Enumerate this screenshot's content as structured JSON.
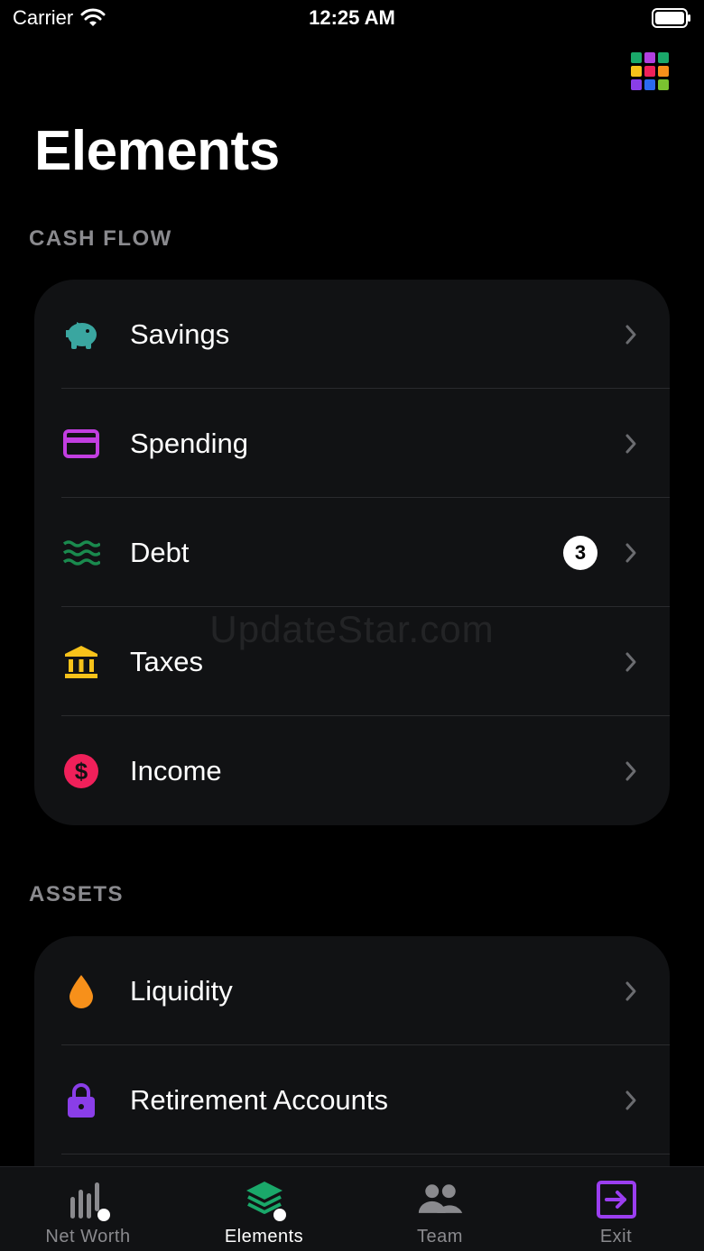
{
  "status_bar": {
    "carrier": "Carrier",
    "time": "12:25 AM"
  },
  "header": {
    "title": "Elements",
    "grid_icon": "apps-grid-icon"
  },
  "sections": {
    "cash_flow": {
      "title": "CASH FLOW",
      "items": [
        {
          "label": "Savings",
          "icon": "piggy-bank-icon",
          "color": "#3aa6a0"
        },
        {
          "label": "Spending",
          "icon": "credit-card-icon",
          "color": "#c23ee0"
        },
        {
          "label": "Debt",
          "icon": "waves-icon",
          "color": "#1a8a4e",
          "badge": "3"
        },
        {
          "label": "Taxes",
          "icon": "bank-icon",
          "color": "#f7c21a"
        },
        {
          "label": "Income",
          "icon": "dollar-circle-icon",
          "color": "#f0205a"
        }
      ]
    },
    "assets": {
      "title": "ASSETS",
      "items": [
        {
          "label": "Liquidity",
          "icon": "drop-icon",
          "color": "#f7901a"
        },
        {
          "label": "Retirement Accounts",
          "icon": "lock-icon",
          "color": "#8a3ee8"
        }
      ]
    }
  },
  "watermark": "UpdateStar.com",
  "tab_bar": {
    "tabs": [
      {
        "label": "Net Worth",
        "icon": "bar-chart-icon"
      },
      {
        "label": "Elements",
        "icon": "layers-icon",
        "active": true
      },
      {
        "label": "Team",
        "icon": "people-icon"
      },
      {
        "label": "Exit",
        "icon": "exit-icon",
        "color": "#9b3ef0"
      }
    ]
  }
}
